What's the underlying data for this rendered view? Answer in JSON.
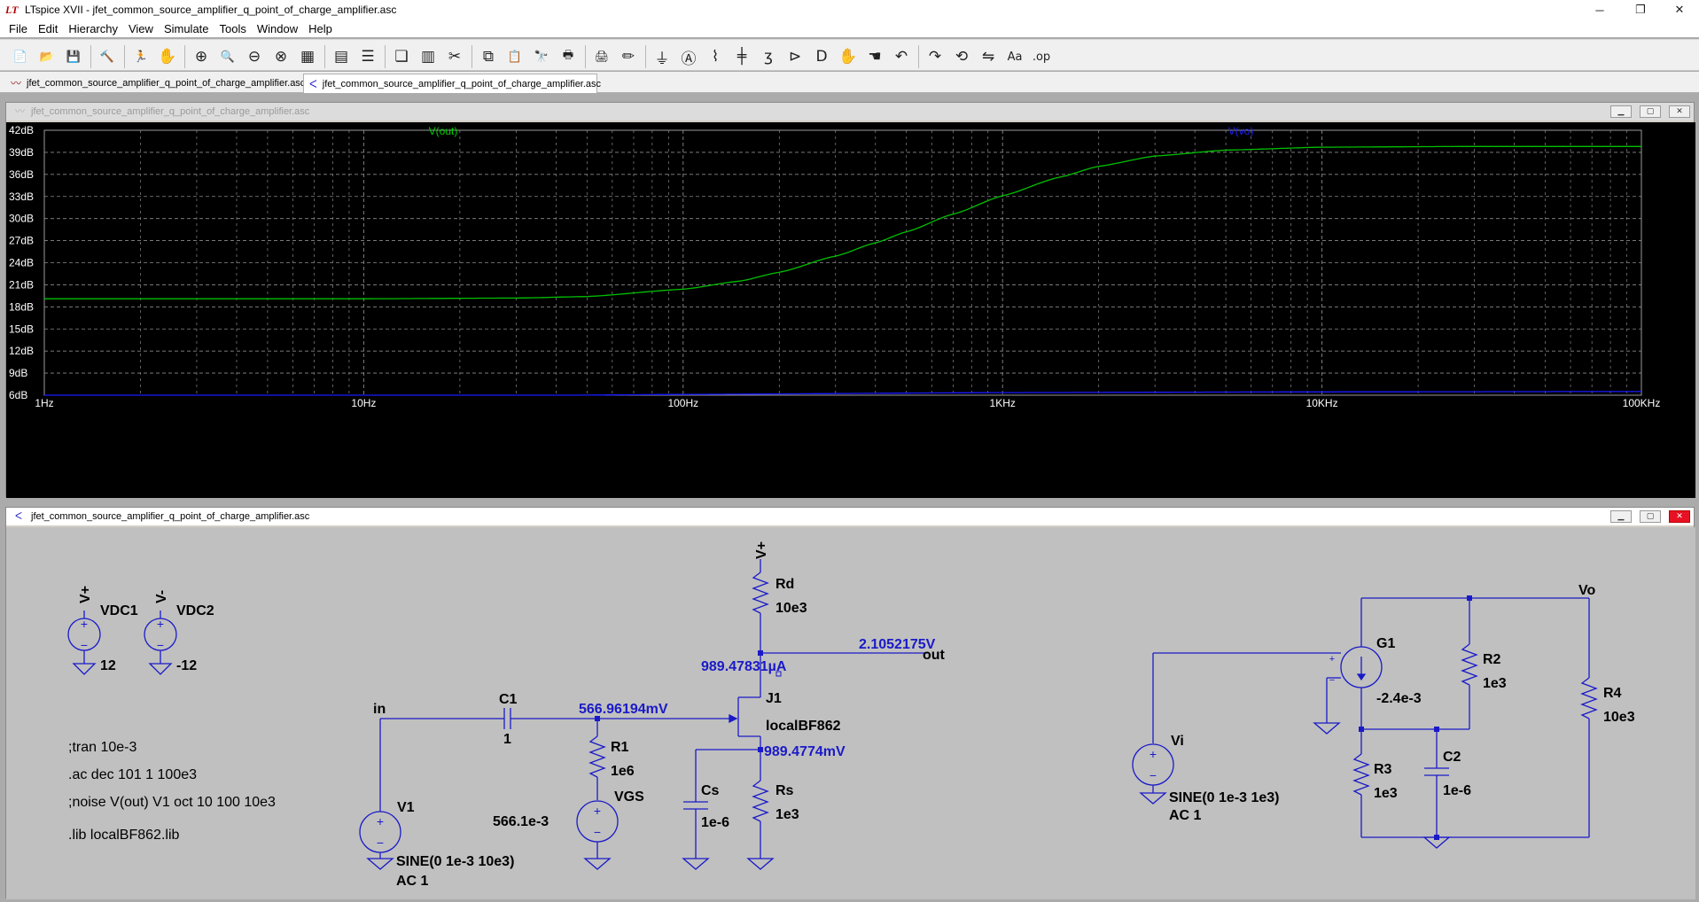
{
  "app": {
    "window_title": "LTspice XVII - jfet_common_source_amplifier_q_point_of_charge_amplifier.asc",
    "logo_text": "LT",
    "controls": {
      "minimize": "─",
      "restore": "❐",
      "close": "✕"
    }
  },
  "menu": [
    "File",
    "Edit",
    "Hierarchy",
    "View",
    "Simulate",
    "Tools",
    "Window",
    "Help"
  ],
  "toolbar": {
    "buttons": [
      {
        "name": "new-schematic-icon",
        "glyph": "📄"
      },
      {
        "name": "open-icon",
        "glyph": "📂"
      },
      {
        "name": "save-icon",
        "glyph": "💾"
      },
      {
        "name": "control-panel-icon",
        "glyph": "🔨"
      },
      {
        "name": "run-icon",
        "glyph": "🏃"
      },
      {
        "name": "halt-icon",
        "glyph": "✋"
      },
      {
        "name": "zoom-in-icon",
        "glyph": "⊕"
      },
      {
        "name": "pan-icon",
        "glyph": "🔍"
      },
      {
        "name": "zoom-out-icon",
        "glyph": "⊖"
      },
      {
        "name": "zoom-fit-icon",
        "glyph": "⊗"
      },
      {
        "name": "autorange-icon",
        "glyph": "▦"
      },
      {
        "name": "plot-settings-icon",
        "glyph": "▤"
      },
      {
        "name": "tile-horizontal-icon",
        "glyph": "☰"
      },
      {
        "name": "cascade-icon",
        "glyph": "❏"
      },
      {
        "name": "tile-vertical-icon",
        "glyph": "▥"
      },
      {
        "name": "cut-icon",
        "glyph": "✂"
      },
      {
        "name": "copy-icon",
        "glyph": "⧉"
      },
      {
        "name": "paste-icon",
        "glyph": "📋"
      },
      {
        "name": "find-icon",
        "glyph": "🔭"
      },
      {
        "name": "print-icon",
        "glyph": "🖶"
      },
      {
        "name": "print-setup-icon",
        "glyph": "🖨"
      },
      {
        "name": "draw-wire-icon",
        "glyph": "✏"
      },
      {
        "name": "ground-icon",
        "glyph": "⏚"
      },
      {
        "name": "label-net-icon",
        "glyph": "Ⓐ"
      },
      {
        "name": "resistor-icon",
        "glyph": "⌇"
      },
      {
        "name": "capacitor-icon",
        "glyph": "╪"
      },
      {
        "name": "inductor-icon",
        "glyph": "ʒ"
      },
      {
        "name": "diode-icon",
        "glyph": "⊳"
      },
      {
        "name": "component-icon",
        "glyph": "D"
      },
      {
        "name": "move-icon",
        "glyph": "✋"
      },
      {
        "name": "drag-icon",
        "glyph": "☚"
      },
      {
        "name": "undo-icon",
        "glyph": "↶"
      },
      {
        "name": "redo-icon",
        "glyph": "↷"
      },
      {
        "name": "rotate-icon",
        "glyph": "⟲"
      },
      {
        "name": "mirror-icon",
        "glyph": "⇋"
      },
      {
        "name": "text-icon",
        "glyph": "Aa"
      },
      {
        "name": "spice-directive-icon",
        "glyph": ".op"
      }
    ]
  },
  "tabs": [
    {
      "label": "jfet_common_source_amplifier_q_point_of_charge_amplifier.asc",
      "icon": "waveform-icon"
    },
    {
      "label": "jfet_common_source_amplifier_q_point_of_charge_amplifier.asc",
      "icon": "schematic-icon"
    }
  ],
  "waveform_panel": {
    "title": "jfet_common_source_amplifier_q_point_of_charge_amplifier.asc",
    "trace_labels": {
      "out": "V(out)",
      "vo": "V(vo)"
    },
    "colors": {
      "bg": "#000000",
      "grid": "#8a8a8a",
      "out": "#00c000",
      "vo": "#1a1aff",
      "label_out": "#00d000",
      "label_vo": "#2020ff"
    }
  },
  "chart_data": {
    "type": "line",
    "title": "",
    "xscale": "log",
    "xlim": [
      1,
      100000
    ],
    "ylim": [
      6,
      42
    ],
    "x_ticks": [
      "1Hz",
      "10Hz",
      "100Hz",
      "1KHz",
      "10KHz",
      "100KHz"
    ],
    "y_ticks": [
      "42dB",
      "39dB",
      "36dB",
      "33dB",
      "30dB",
      "27dB",
      "24dB",
      "21dB",
      "18dB",
      "15dB",
      "12dB",
      "9dB",
      "6dB"
    ],
    "y_tick_values": [
      42,
      39,
      36,
      33,
      30,
      27,
      24,
      21,
      18,
      15,
      12,
      9,
      6
    ],
    "grid": true,
    "series": [
      {
        "name": "V(out)",
        "x": [
          1,
          10,
          30,
          50,
          100,
          150,
          200,
          300,
          400,
          500,
          700,
          1000,
          1500,
          2000,
          3000,
          5000,
          10000,
          30000,
          100000
        ],
        "y": [
          19.1,
          19.1,
          19.2,
          19.4,
          20.4,
          21.5,
          22.7,
          24.9,
          26.7,
          28.2,
          30.6,
          33.1,
          35.6,
          37.1,
          38.5,
          39.3,
          39.7,
          39.8,
          39.8
        ]
      },
      {
        "name": "V(vo)",
        "x": [
          1,
          10,
          30,
          100,
          1000,
          10000,
          100000
        ],
        "y": [
          5.9,
          5.9,
          5.95,
          6.1,
          6.35,
          6.45,
          6.5
        ]
      }
    ]
  },
  "schematic_panel": {
    "title": "jfet_common_source_amplifier_q_point_of_charge_amplifier.asc",
    "colors": {
      "bg": "#c0c0c0",
      "wire": "#1a1ac8",
      "text": "#000000",
      "annotation": "#1a1ac8"
    },
    "sources": {
      "vdc1": {
        "name": "VDC1",
        "net": "V+",
        "value": "12"
      },
      "vdc2": {
        "name": "VDC2",
        "net": "V-",
        "value": "-12"
      }
    },
    "directives": [
      ";tran 10e-3",
      ".ac dec 101 1 100e3",
      ";noise V(out) V1 oct 10 100 10e3",
      ".lib localBF862.lib"
    ],
    "components": {
      "rd": {
        "name": "Rd",
        "value": "10e3"
      },
      "vplus": "V+",
      "c1": {
        "name": "C1",
        "value": "1"
      },
      "r1": {
        "name": "R1",
        "value": "1e6"
      },
      "vgs": {
        "name": "VGS",
        "value": "566.1e-3"
      },
      "j1": {
        "name": "J1",
        "model": "localBF862"
      },
      "cs": {
        "name": "Cs",
        "value": "1e-6"
      },
      "rs": {
        "name": "Rs",
        "value": "1e3"
      },
      "v1": {
        "name": "V1",
        "value1": "SINE(0 1e-3 10e3)",
        "value2": "AC 1"
      },
      "g1": {
        "name": "G1",
        "value": "-2.4e-3"
      },
      "r2": {
        "name": "R2",
        "value": "1e3"
      },
      "r3": {
        "name": "R3",
        "value": "1e3"
      },
      "c2": {
        "name": "C2",
        "value": "1e-6"
      },
      "r4": {
        "name": "R4",
        "value": "10e3"
      },
      "vi": {
        "name": "Vi",
        "value1": "SINE(0 1e-3 1e3)",
        "value2": "AC 1"
      }
    },
    "net_labels": {
      "in": "in",
      "out": "out",
      "vo": "Vo"
    },
    "op_annotations": {
      "v_out": "2.1052175V",
      "i_drain": "989.47831µA",
      "v_gate": "566.96194mV",
      "v_source": "989.4774mV"
    }
  }
}
